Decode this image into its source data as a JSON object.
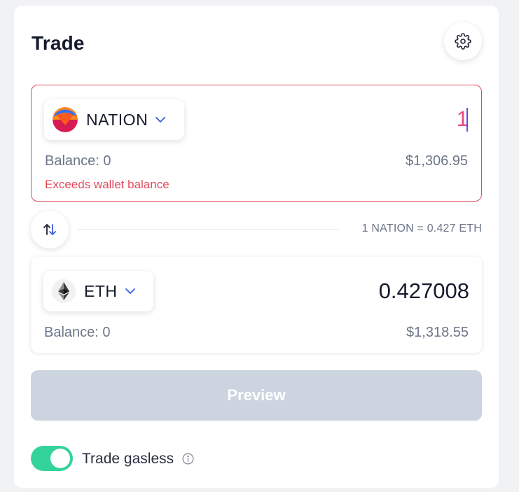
{
  "header": {
    "title": "Trade",
    "settings_icon": "gear-icon"
  },
  "from": {
    "token_symbol": "NATION",
    "token_icon": "nation-logo-icon",
    "amount": "1",
    "balance_label": "Balance:  0",
    "usd_value": "$1,306.95",
    "error_text": "Exceeds wallet balance"
  },
  "rate": {
    "text": "1 NATION = 0.427 ETH",
    "swap_icon": "swap-arrows-icon"
  },
  "to": {
    "token_symbol": "ETH",
    "token_icon": "eth-logo-icon",
    "amount": "0.427008",
    "balance_label": "Balance:  0",
    "usd_value": "$1,318.55"
  },
  "actions": {
    "preview_label": "Preview"
  },
  "gasless": {
    "label": "Trade gasless",
    "enabled": true,
    "info_icon": "info-icon"
  },
  "colors": {
    "error": "#e3495a",
    "toggle_on": "#34d399",
    "button_disabled": "#cbd4df",
    "accent_chevron": "#3b5bdb"
  }
}
